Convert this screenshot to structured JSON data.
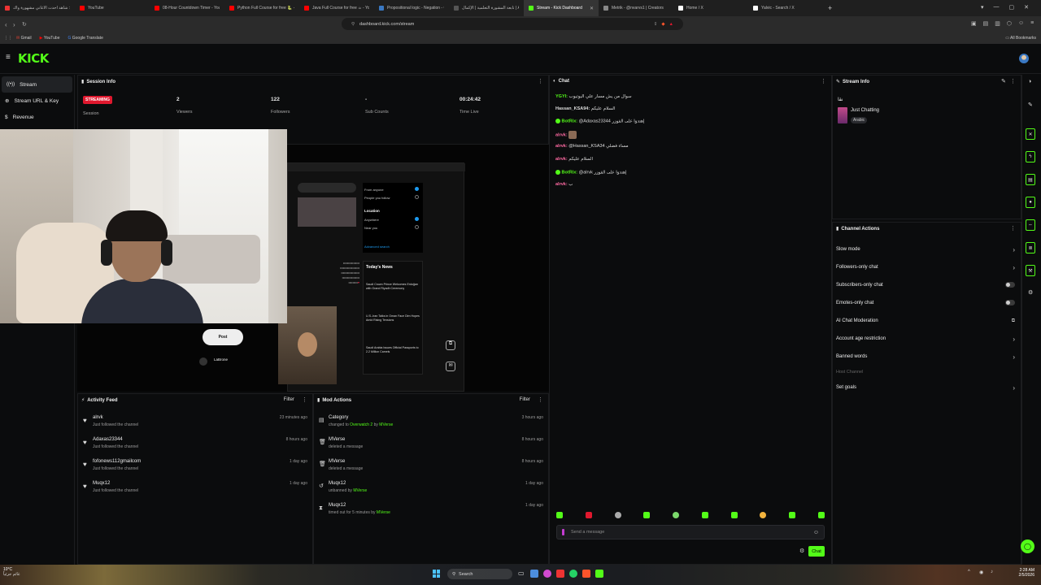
{
  "browser": {
    "tabs": [
      {
        "label": "كرانيني رول: شاهد أحدث الأغاني مشهورة واك",
        "color": "#e33"
      },
      {
        "label": "YouTube",
        "color": "#f00"
      },
      {
        "label": "08-Hour Countdown Timer - YouTub",
        "color": "#f00"
      },
      {
        "label": "Python Full Course for free 🐍 - You",
        "color": "#f00"
      },
      {
        "label": "Java Full Course for free ☕ - YouTub",
        "color": "#f00"
      },
      {
        "label": "Propositional logic - Negation - Chec",
        "color": "#3a78c2"
      },
      {
        "label": "تابعة المشورة التعلمية | الإكمال | AA",
        "color": "#555"
      },
      {
        "label": "Stream - Kick Dashboard",
        "color": "#53fc18",
        "active": true
      },
      {
        "label": "Metrik - @nvarvs1 | Creators",
        "color": "#888"
      },
      {
        "label": "Home / X",
        "color": "#fff"
      },
      {
        "label": "Yalvic - Search / X",
        "color": "#fff"
      }
    ],
    "url": "dashboard.kick.com/stream",
    "bookmarks": [
      "Gmail",
      "YouTube",
      "Google Translate"
    ],
    "all_bookmarks": "All Bookmarks"
  },
  "app": {
    "logo": "KICK"
  },
  "sidebar": {
    "items": [
      {
        "label": "Stream",
        "icon": "broadcast-icon",
        "active": true
      },
      {
        "label": "Stream URL & Key",
        "icon": "globe-icon"
      },
      {
        "label": "Revenue",
        "icon": "dollar-icon"
      }
    ]
  },
  "session_info": {
    "title": "Session Info",
    "status": "STREAMING",
    "session_label": "Session",
    "stats": [
      {
        "value": "2",
        "label": "Viewers"
      },
      {
        "value": "122",
        "label": "Followers"
      },
      {
        "value": "-",
        "label": "Sub Counts"
      },
      {
        "value": "00:24:42",
        "label": "Time Live"
      }
    ]
  },
  "preview": {
    "post_button": "Post",
    "todays_news": "Today's News",
    "news": [
      "Saudi Crown Prince Welcomes Erdoğan with Grand Riyadh Ceremony",
      "U.S.-Iran Talks in Oman Face Dim Hopes Amid Rising Tensions",
      "Saudi Arabia Issues Official Passports to 2.2 Million Camels"
    ],
    "location_label": "Location",
    "options": [
      "From anyone",
      "People you follow",
      "Anywhere",
      "Near you"
    ],
    "advanced": "Advanced search",
    "profile_name": "LaBrone"
  },
  "activity_feed": {
    "title": "Activity Feed",
    "filter": "Filter",
    "items": [
      {
        "name": "alrvk",
        "sub": "Just followed the channel",
        "time": "23 minutes ago"
      },
      {
        "name": "Adaxas23344",
        "sub": "Just followed the channel",
        "time": "8 hours ago"
      },
      {
        "name": "fofonews112gmailcom",
        "sub": "Just followed the channel",
        "time": "1 day ago"
      },
      {
        "name": "Muqx12",
        "sub": "Just followed the channel",
        "time": "1 day ago"
      }
    ]
  },
  "mod_actions": {
    "title": "Mod Actions",
    "filter": "Filter",
    "items": [
      {
        "name": "Category",
        "pre": "changed to",
        "target": "Overwatch 2",
        "mid": " by ",
        "by": "MVerse",
        "time": "3 hours ago",
        "icon": "category-icon"
      },
      {
        "name": "MVerse",
        "pre": "deleted a message",
        "target": "",
        "mid": "",
        "by": "",
        "time": "8 hours ago",
        "icon": "trash-icon"
      },
      {
        "name": "MVerse",
        "pre": "deleted a message",
        "target": "",
        "mid": "",
        "by": "",
        "time": "8 hours ago",
        "icon": "trash-icon"
      },
      {
        "name": "Muqx12",
        "pre": "unbanned by",
        "target": "",
        "mid": " ",
        "by": "MVerse",
        "time": "1 day ago",
        "icon": "undo-icon"
      },
      {
        "name": "Muqx12",
        "pre": "timed out for 5 minutes by",
        "target": "",
        "mid": " ",
        "by": "MVerse",
        "time": "1 day ago",
        "icon": "hourglass-icon"
      }
    ]
  },
  "chat": {
    "title": "Chat",
    "messages": [
      {
        "user": "YGYI:",
        "color": "#53fc18",
        "text": "سوال من يش مسار علي اليوتيوب"
      },
      {
        "user": "Hassan_KSA94:",
        "color": "#e6e6e6",
        "text": "السلام عليكم"
      },
      {
        "user": "BotRix:",
        "color": "#53fc18",
        "text": "@Adaxas23344 إهتدوا على الفوزر",
        "bot": true
      },
      {
        "user": "alrvk:",
        "color": "#ff6aa2",
        "text": ""
      },
      {
        "user": "alrvk:",
        "color": "#ff6aa2",
        "text": "@Hassan_KSA34 مساء فضلي"
      },
      {
        "user": "alrvk:",
        "color": "#ff6aa2",
        "text": "السلام عليكم"
      },
      {
        "user": "BotRix:",
        "color": "#53fc18",
        "text": "@alrvk إهتدوا على الفوزر",
        "bot": true
      },
      {
        "user": "alrvk:",
        "color": "#ff6aa2",
        "text": "ب"
      }
    ],
    "placeholder": "Send a message",
    "send_button": "Chat"
  },
  "stream_info": {
    "title": "Stream Info",
    "stream_title": "نقا",
    "category": "Just Chatting",
    "language": "Arabic"
  },
  "channel_actions": {
    "title": "Channel Actions",
    "items": [
      {
        "label": "Slow mode",
        "control": "chevron"
      },
      {
        "label": "Followers-only chat",
        "control": "chevron"
      },
      {
        "label": "Subscribers-only chat",
        "control": "toggle"
      },
      {
        "label": "Emotes-only chat",
        "control": "toggle"
      },
      {
        "label": "AI Chat Moderation",
        "control": "external"
      },
      {
        "label": "Account age restriction",
        "control": "chevron"
      },
      {
        "label": "Banned words",
        "control": "chevron"
      },
      {
        "label": "Host Channel",
        "control": "none",
        "disabled": true
      },
      {
        "label": "Set goals",
        "control": "chevron"
      }
    ]
  },
  "taskbar": {
    "weather_temp": "10°C",
    "weather_desc": "غائم جزئياً",
    "search": "Search",
    "time": "2:28 AM",
    "date": "2/5/2026"
  },
  "colors": {
    "accent": "#53fc18",
    "streaming": "#e0182e",
    "bg": "#0b0c0d"
  }
}
